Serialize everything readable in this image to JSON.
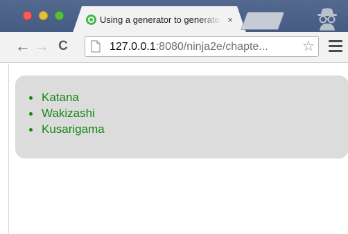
{
  "window": {
    "controls": [
      "close",
      "minimize",
      "maximize"
    ]
  },
  "tab": {
    "favicon": "qunit-favicon-icon",
    "title": "Using a generator to generate",
    "close_label": "×"
  },
  "toolbar": {
    "back_icon": "←",
    "forward_icon": "→",
    "reload_icon": "C",
    "address": {
      "host": "127.0.0.1",
      "rest": ":8080/ninja2e/chapte..."
    },
    "bookmark_icon": "☆"
  },
  "page": {
    "ninjas": [
      "Katana",
      "Wakizashi",
      "Kusarigama"
    ]
  },
  "colors": {
    "titlebar": "#4d6389",
    "toolbar": "#f2f2f2",
    "list_text": "#118811",
    "box_background": "#dcdcdc"
  }
}
